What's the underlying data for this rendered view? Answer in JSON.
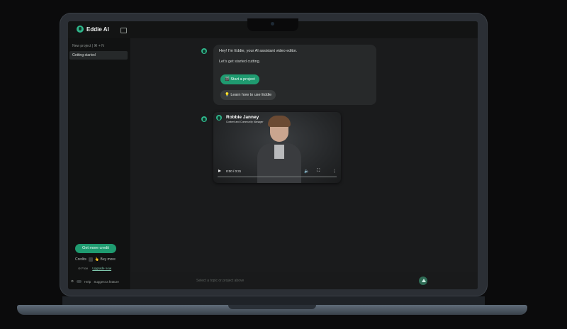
{
  "app": {
    "brand": "Eddie AI"
  },
  "sidebar": {
    "new_project": "New project | ⌘ + N",
    "items": [
      {
        "label": "Getting started"
      }
    ],
    "get_credit": "Get more credit",
    "credits_label": "Credits",
    "buy_more": "Buy more",
    "plan": "Free",
    "upgrade": "Upgrade now",
    "help": "Help",
    "suggest": "Suggest a feature"
  },
  "chat": {
    "greeting": "Hey! I'm Eddie, your AI assistant video editor.",
    "prompt": "Let's get started cutting.",
    "start_button": "🎬 Start a project",
    "learn_button": "💡 Learn how to use Eddie"
  },
  "video": {
    "name": "Robbie Janney",
    "role": "Content and Community Manager",
    "time": "0:00 / 0:31"
  },
  "input": {
    "placeholder": "Select a topic or project above"
  },
  "colors": {
    "accent": "#1f9b70",
    "background": "#151617"
  }
}
